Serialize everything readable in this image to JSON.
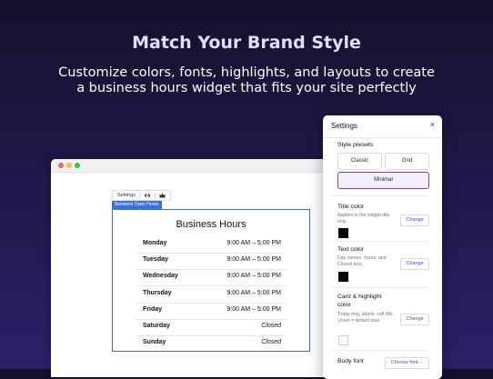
{
  "hero": {
    "headline": "Match Your Brand Style",
    "subline_1": "Customize colors, fonts, highlights, and layouts to create",
    "subline_2": "a business hours widget that fits your site perfectly"
  },
  "toolbar": {
    "settings_label": "Settings",
    "icons": [
      "swap-icon",
      "crown-icon"
    ]
  },
  "widget": {
    "tag": "Business Open Hours",
    "title": "Business Hours",
    "rows": [
      {
        "day": "Monday",
        "time": "9:00 AM – 5:00 PM",
        "closed": false
      },
      {
        "day": "Tuesday",
        "time": "9:00 AM – 5:00 PM",
        "closed": false
      },
      {
        "day": "Wednesday",
        "time": "9:00 AM – 5:00 PM",
        "closed": false
      },
      {
        "day": "Thursday",
        "time": "9:00 AM – 5:00 PM",
        "closed": false
      },
      {
        "day": "Friday",
        "time": "9:00 AM – 5:00 PM",
        "closed": false
      },
      {
        "day": "Saturday",
        "time": "Closed",
        "closed": true
      },
      {
        "day": "Sunday",
        "time": "Closed",
        "closed": true
      }
    ]
  },
  "panel": {
    "title": "Settings",
    "close_icon": "×",
    "presets_label": "Style presets",
    "presets": [
      "Classic",
      "Grid",
      "Minimal"
    ],
    "selected_preset": "Minimal",
    "title_color": {
      "label": "Title color",
      "desc": "Applies to the widget title only.",
      "change": "Change",
      "value": "#000000"
    },
    "text_color": {
      "label": "Text color",
      "desc": "Day names, hours, and Closed text.",
      "change": "Change",
      "value": "#000000"
    },
    "card_color": {
      "label_1": "Card & highlight",
      "label_2": "color",
      "desc": "Today ring, labels, soft fills. Unset = default blue.",
      "change": "Change",
      "value": "#ffffff"
    },
    "body_font": {
      "label": "Body font",
      "button": "Choose font…"
    }
  },
  "colors": {
    "accent": "#7a3fe0",
    "widget_border": "#3b6fe0",
    "change_text": "#5b3cc4"
  }
}
